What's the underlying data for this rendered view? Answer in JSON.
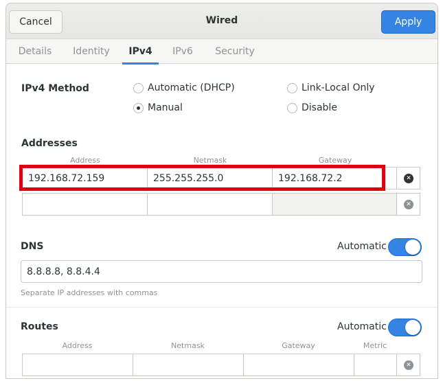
{
  "header": {
    "cancel_label": "Cancel",
    "title": "Wired",
    "apply_label": "Apply"
  },
  "tabs": [
    {
      "label": "Details",
      "active": false
    },
    {
      "label": "Identity",
      "active": false
    },
    {
      "label": "IPv4",
      "active": true
    },
    {
      "label": "IPv6",
      "active": false
    },
    {
      "label": "Security",
      "active": false
    }
  ],
  "ipv4_method": {
    "title": "IPv4 Method",
    "options": [
      {
        "label": "Automatic (DHCP)",
        "checked": false
      },
      {
        "label": "Link-Local Only",
        "checked": false
      },
      {
        "label": "Manual",
        "checked": true
      },
      {
        "label": "Disable",
        "checked": false
      }
    ]
  },
  "addresses": {
    "title": "Addresses",
    "columns": [
      "Address",
      "Netmask",
      "Gateway"
    ],
    "rows": [
      {
        "address": "192.168.72.159",
        "netmask": "255.255.255.0",
        "gateway": "192.168.72.2"
      },
      {
        "address": "",
        "netmask": "",
        "gateway": ""
      }
    ]
  },
  "dns": {
    "title": "DNS",
    "automatic_label": "Automatic",
    "automatic_on": true,
    "value": "8.8.8.8, 8.8.4.4",
    "hint": "Separate IP addresses with commas"
  },
  "routes": {
    "title": "Routes",
    "automatic_label": "Automatic",
    "automatic_on": true,
    "columns": [
      "Address",
      "Netmask",
      "Gateway",
      "Metric"
    ]
  },
  "colors": {
    "accent": "#3584e4",
    "highlight": "#e1000f"
  }
}
